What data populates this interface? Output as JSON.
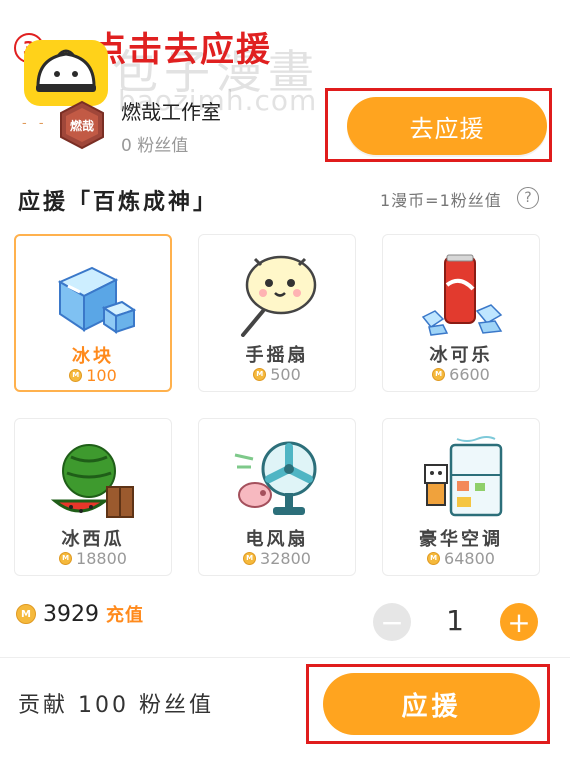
{
  "overlay": {
    "step_number": "3",
    "instruction": "点击去应援",
    "watermark_cn": "包子漫畫",
    "watermark_url": "baozimh.com"
  },
  "studio": {
    "dash": "- -",
    "avatar_text": "燃哉",
    "name": "燃哉工作室",
    "fans": "0 粉丝值",
    "go_label": "去应援"
  },
  "section": {
    "title": "应援「百炼成神」",
    "rate": "1漫币=1粉丝值",
    "help": "?"
  },
  "gifts": [
    {
      "name": "冰块",
      "price": "100",
      "icon": "ice-cube-icon"
    },
    {
      "name": "手摇扇",
      "price": "500",
      "icon": "hand-fan-icon"
    },
    {
      "name": "冰可乐",
      "price": "6600",
      "icon": "iced-cola-icon"
    },
    {
      "name": "冰西瓜",
      "price": "18800",
      "icon": "watermelon-icon"
    },
    {
      "name": "电风扇",
      "price": "32800",
      "icon": "electric-fan-icon"
    },
    {
      "name": "豪华空调",
      "price": "64800",
      "icon": "luxury-ac-icon"
    }
  ],
  "selected_gift": "冰块",
  "coin_symbol": "M",
  "balance": {
    "amount": "3929",
    "recharge_label": "充值"
  },
  "quantity": {
    "minus": "−",
    "value": "1",
    "plus": "+"
  },
  "footer": {
    "contribution": "贡献 100 粉丝值",
    "support_label": "应援"
  },
  "colors": {
    "accent": "#ffa41f",
    "accent_text": "#ff8a1c",
    "highlight": "#e01c1c"
  }
}
